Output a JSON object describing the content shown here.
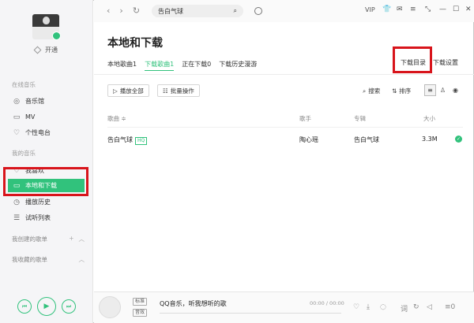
{
  "sidebar": {
    "vip_label": "开通",
    "online_music_title": "在线音乐",
    "online_items": [
      {
        "label": "音乐馆",
        "icon": "music-hall-icon"
      },
      {
        "label": "MV",
        "icon": "mv-icon"
      },
      {
        "label": "个性电台",
        "icon": "radio-icon"
      }
    ],
    "my_music_title": "我的音乐",
    "my_items": [
      {
        "label": "我喜欢",
        "icon": "heart-icon"
      },
      {
        "label": "本地和下载",
        "icon": "monitor-icon"
      },
      {
        "label": "播放历史",
        "icon": "history-icon"
      },
      {
        "label": "试听列表",
        "icon": "playlist-icon"
      }
    ],
    "created_playlists": "我创建的歌单",
    "favorited_playlists": "我收藏的歌单"
  },
  "topbar": {
    "search_value": "告白气球",
    "vip": "VIP"
  },
  "main": {
    "title": "本地和下载",
    "tabs": [
      {
        "label": "本地歌曲1",
        "active": false
      },
      {
        "label": "下载歌曲1",
        "active": true
      },
      {
        "label": "正在下载0",
        "active": false
      },
      {
        "label": "下载历史漫游",
        "active": false
      }
    ],
    "download_dir": "下载目录",
    "download_settings": "下载设置",
    "play_all": "播放全部",
    "batch_ops": "批量操作",
    "search_label": "搜索",
    "sort_label": "排序",
    "columns": {
      "song": "歌曲 ≑",
      "artist": "歌手",
      "album": "专辑",
      "size": "大小"
    },
    "rows": [
      {
        "song": "告白气球",
        "quality": "HQ",
        "artist": "陶心瑶",
        "album": "告白气球",
        "size": "3.3M"
      }
    ]
  },
  "player": {
    "tag_top": "标准",
    "tag_bottom": "音效",
    "now_playing": "QQ音乐，听我想听的歌",
    "time": "00:00 / 00:00"
  },
  "colors": {
    "accent": "#31c27c",
    "highlight": "#d8141b"
  }
}
